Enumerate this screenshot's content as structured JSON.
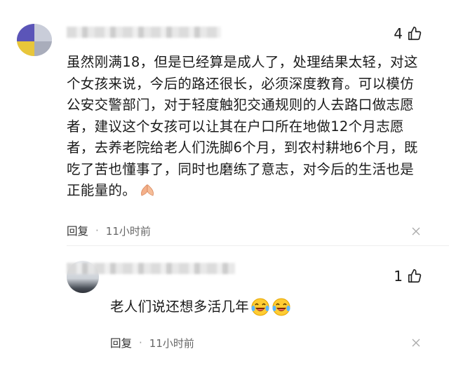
{
  "comment": {
    "likes": "4",
    "text": "虽然刚满18，但是已经算是成人了，处理结果太轻，对这个女孩来说，今后的路还很长，必须深度教育。可以模仿公安交警部门，对于轻度触犯交通规则的人去路口做志愿者，建议这个女孩可以让其在户口所在地做12个月志愿者，去养老院给老人们洗脚6个月，到农村耕地6个月，既吃了苦也懂事了，同时也磨练了意志，对今后的生活也是正能量的。",
    "reply_label": "回复",
    "separator": "·",
    "time": "11小时前"
  },
  "reply": {
    "likes": "1",
    "text": "老人们说还想多活几年",
    "reply_label": "回复",
    "separator": "·",
    "time": "11小时前"
  },
  "icons": {
    "like": "thumbs-up-icon",
    "more": "more-icon",
    "pray": "pray-emoji",
    "laugh": "laughing-tears-emoji"
  }
}
